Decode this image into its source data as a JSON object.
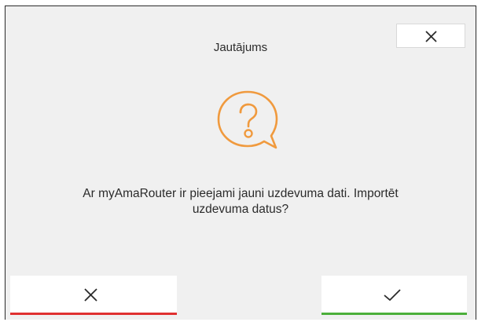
{
  "dialog": {
    "title": "Jautājums",
    "message_line1": "Ar myAmaRouter ir pieejami jauni uzdevuma dati. Importēt",
    "message_line2": "uzdevuma datus?",
    "icon": "question-speech-bubble-icon",
    "close_icon": "close-icon",
    "cancel_icon": "close-icon",
    "confirm_icon": "checkmark-icon"
  },
  "colors": {
    "accent": "#f09a3e",
    "cancel": "#e03030",
    "confirm": "#4caf3a",
    "background": "#f0f0f0"
  }
}
